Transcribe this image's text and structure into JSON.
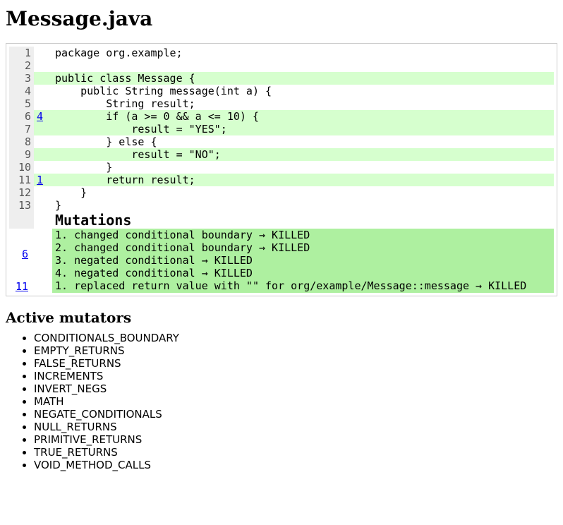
{
  "title": "Message.java",
  "colors": {
    "covered": "#d6ffce",
    "muted": "#aef0a0",
    "gutter": "#eeeeee",
    "link": "#0000ee"
  },
  "source": [
    {
      "n": 1,
      "covered": false,
      "cov": "",
      "text": "package org.example;"
    },
    {
      "n": 2,
      "covered": false,
      "cov": "",
      "text": ""
    },
    {
      "n": 3,
      "covered": true,
      "cov": "",
      "text": "public class Message {"
    },
    {
      "n": 4,
      "covered": false,
      "cov": "",
      "text": "    public String message(int a) {"
    },
    {
      "n": 5,
      "covered": false,
      "cov": "",
      "text": "        String result;"
    },
    {
      "n": 6,
      "covered": true,
      "cov": "4",
      "text": "        if (a >= 0 && a <= 10) {"
    },
    {
      "n": 7,
      "covered": true,
      "cov": "",
      "text": "            result = \"YES\";"
    },
    {
      "n": 8,
      "covered": false,
      "cov": "",
      "text": "        } else {"
    },
    {
      "n": 9,
      "covered": true,
      "cov": "",
      "text": "            result = \"NO\";"
    },
    {
      "n": 10,
      "covered": false,
      "cov": "",
      "text": "        }"
    },
    {
      "n": 11,
      "covered": true,
      "cov": "1",
      "text": "        return result;"
    },
    {
      "n": 12,
      "covered": false,
      "cov": "",
      "text": "    }"
    },
    {
      "n": 13,
      "covered": false,
      "cov": "",
      "text": "}"
    }
  ],
  "mutations_heading": "Mutations",
  "mutations": [
    {
      "line": "6",
      "items": [
        "1. changed conditional boundary → KILLED",
        "2. changed conditional boundary → KILLED",
        "3. negated conditional → KILLED",
        "4. negated conditional → KILLED"
      ]
    },
    {
      "line": "11",
      "items": [
        "1. replaced return value with \"\" for org/example/Message::message → KILLED"
      ]
    }
  ],
  "mutators_heading": "Active mutators",
  "mutators": [
    "CONDITIONALS_BOUNDARY",
    "EMPTY_RETURNS",
    "FALSE_RETURNS",
    "INCREMENTS",
    "INVERT_NEGS",
    "MATH",
    "NEGATE_CONDITIONALS",
    "NULL_RETURNS",
    "PRIMITIVE_RETURNS",
    "TRUE_RETURNS",
    "VOID_METHOD_CALLS"
  ]
}
